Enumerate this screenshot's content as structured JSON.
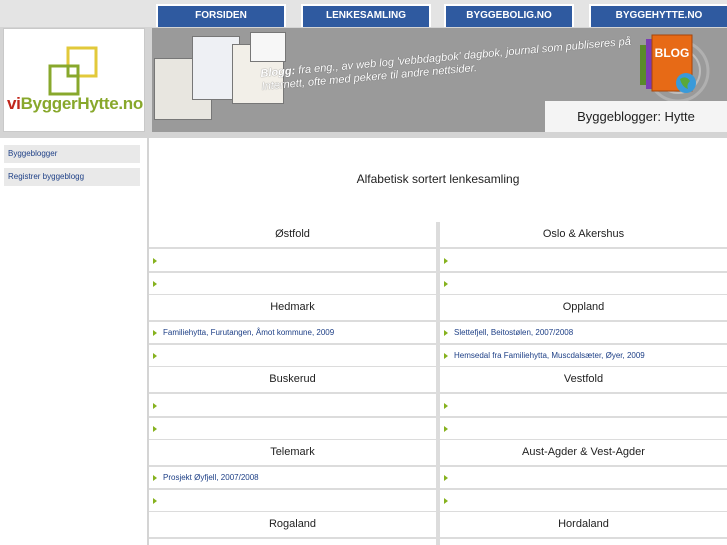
{
  "nav": {
    "items": [
      {
        "label": "FORSIDEN"
      },
      {
        "label": "LENKESAMLING"
      },
      {
        "label": "BYGGEBOLIG.NO"
      },
      {
        "label": "BYGGEHYTTE.NO"
      }
    ]
  },
  "logo": {
    "prefix": "vi",
    "rest": "ByggerHytte.no"
  },
  "banner": {
    "blog_word": "Blogg:",
    "definition": "fra eng., av web log 'vebbdagbok' dagbok, journal som publiseres på Internett, ofte med pekere til andre nettsider.",
    "subtitle": "Byggeblogger: Hytte",
    "book_label": "BLOG"
  },
  "sidebar": {
    "items": [
      {
        "label": "Byggeblogger"
      },
      {
        "label": "Registrer byggeblogg"
      }
    ]
  },
  "main": {
    "title": "Alfabetisk sortert lenkesamling",
    "regions": {
      "ostfold": "Østfold",
      "oslo": "Oslo & Akershus",
      "hedmark": "Hedmark",
      "oppland": "Oppland",
      "buskerud": "Buskerud",
      "vestfold": "Vestfold",
      "telemark": "Telemark",
      "agder": "Aust-Agder & Vest-Agder",
      "rogaland": "Rogaland",
      "hordaland": "Hordaland"
    },
    "links": {
      "hedmark_1": "Familiehytta, Furutangen, Åmot kommune, 2009",
      "oppland_1": "Slettefjell, Beitostølen, 2007/2008",
      "oppland_2": "Hemsedal fra Familiehytta, Muscdalsæter, Øyer, 2009",
      "telemark_1": "Prosjekt Øyfjell, 2007/2008"
    }
  },
  "colors": {
    "nav_bg": "#2f5aa0",
    "link": "#1d3f86",
    "arrow": "#86b21e",
    "logo_green": "#88a82c",
    "logo_red": "#c0261b"
  }
}
